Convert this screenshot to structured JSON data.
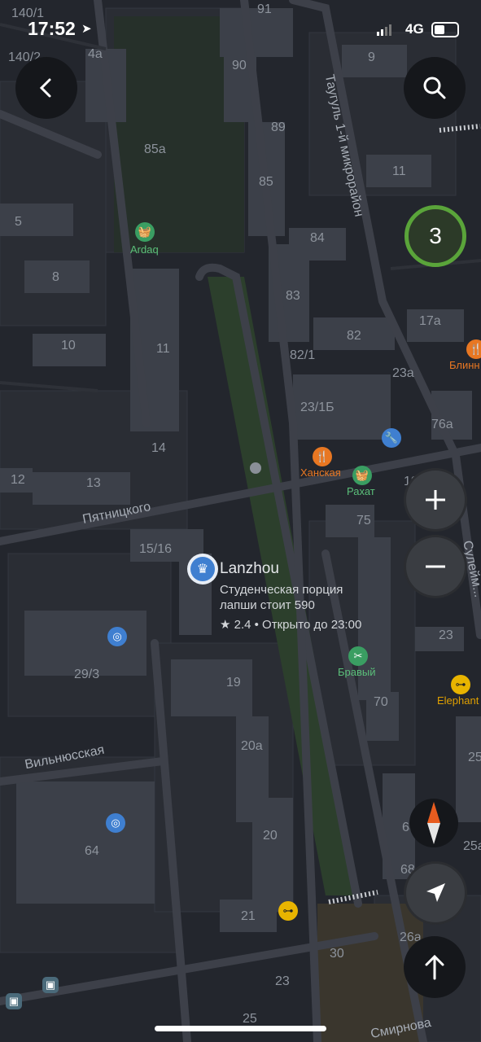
{
  "status_bar": {
    "time": "17:52",
    "network": "4G"
  },
  "buildings": [
    "140/1",
    "140/2",
    "4a",
    "91",
    "9",
    "90",
    "89",
    "85a",
    "85",
    "11",
    "5",
    "84",
    "8",
    "83",
    "82",
    "17a",
    "10",
    "11",
    "82/1",
    "23a",
    "23/1Б",
    "76a",
    "14",
    "12",
    "13",
    "75",
    "19",
    "15/16",
    "23",
    "29/3",
    "19",
    "70",
    "20a",
    "25",
    "64",
    "20",
    "68",
    "25a",
    "68",
    "21",
    "26a",
    "30",
    "23",
    "25"
  ],
  "streets": {
    "taugul": "Таугуль 1-й микрорайон",
    "pyatnitskogo": "Пятницкого",
    "vilnyusskaya": "Вильнюсская",
    "suleimenova": "Сулейм...",
    "smirnova": "Смирнова"
  },
  "pois": {
    "ardaq": "Ardaq",
    "blinnaya": "Блинн",
    "hanskaya": "Ханская",
    "rahat": "Рахат",
    "bravyi": "Бравый",
    "elephant": "Elephant"
  },
  "place_card": {
    "name": "Lanzhou",
    "line1": "Студенческая порция",
    "line2": "лапши стоит 590",
    "rating": "★ 2.4 • Открыто до 23:00"
  },
  "controls": {
    "cluster_count": "3"
  },
  "colors": {
    "background": "#23262d",
    "green_badge": "#5aa43a",
    "orange_poi": "#e87722",
    "park": "#2f4a2f"
  }
}
